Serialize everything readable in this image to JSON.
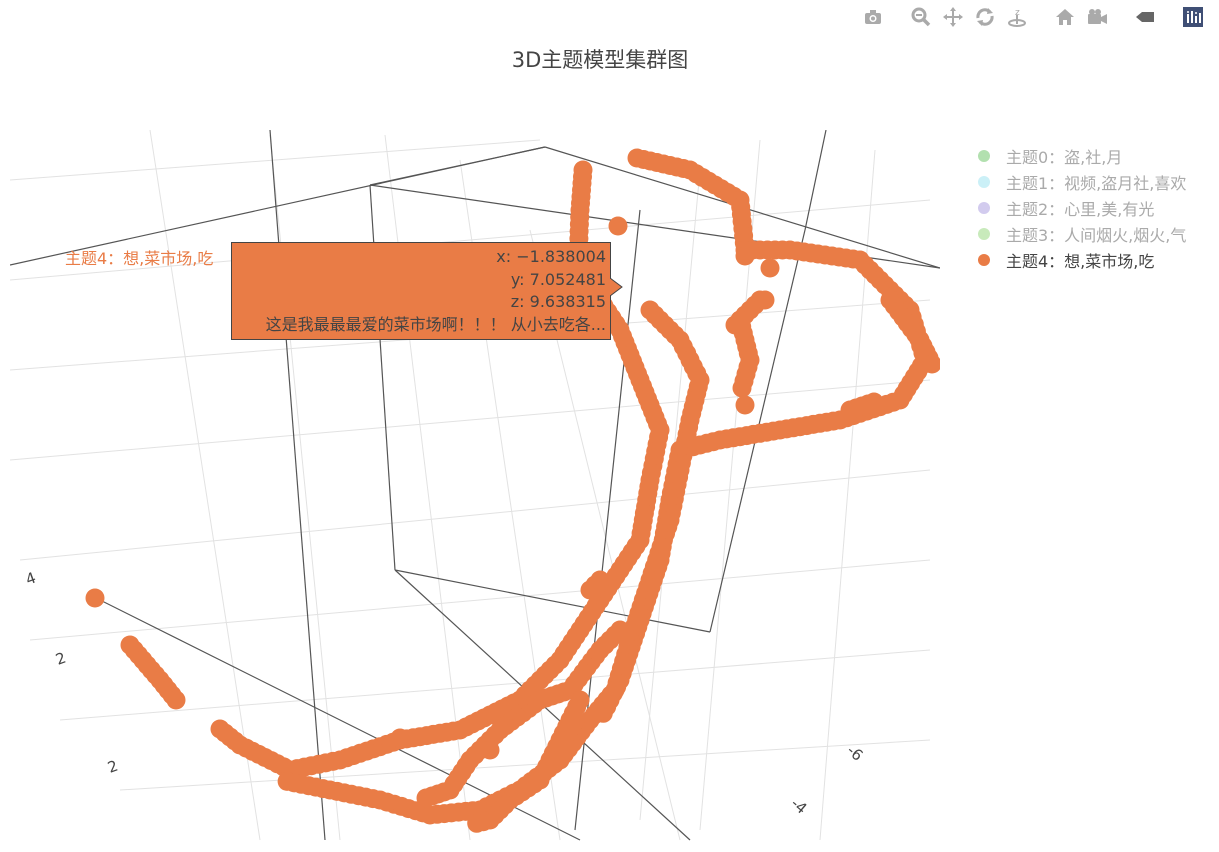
{
  "modebar": {
    "buttons": [
      {
        "name": "camera-icon",
        "group": 0
      },
      {
        "name": "zoom-icon",
        "group": 1
      },
      {
        "name": "pan-icon",
        "group": 1
      },
      {
        "name": "orbit-rotate-icon",
        "group": 1
      },
      {
        "name": "turntable-rotate-icon",
        "group": 1
      },
      {
        "name": "home-icon",
        "group": 2
      },
      {
        "name": "camera-view-icon",
        "group": 2
      },
      {
        "name": "hover-spike-icon",
        "group": 3
      },
      {
        "name": "plotly-logo-icon",
        "group": 4
      }
    ]
  },
  "chart_data": {
    "type": "scatter3d",
    "title": "3D主题模型集群图",
    "legend": {
      "placement": "right",
      "items": [
        {
          "label": "主题0：盗,社,月",
          "color": "#7ecb79",
          "visible": false
        },
        {
          "label": "主题1：视频,盗月社,喜欢",
          "color": "#a8e6f2",
          "visible": false
        },
        {
          "label": "主题2：心里,美,有光",
          "color": "#b4a9e3",
          "visible": false
        },
        {
          "label": "主题3：人间烟火,烟火,气",
          "color": "#a3dc8d",
          "visible": false
        },
        {
          "label": "主题4：想,菜市场,吃",
          "color": "#e97c46",
          "visible": true
        }
      ]
    },
    "tick_labels": [
      "4",
      "2",
      "2",
      "-6",
      "-4"
    ],
    "hover": {
      "trace_name": "主题4：想,菜市场,吃",
      "x": "x: −1.838004",
      "y": "y: 7.052481",
      "z": "z: 9.638315",
      "text": "这是我最最最爱的菜市场啊！！！ 从小去吃各..."
    },
    "marker_color": "#e97c46",
    "grid": true
  }
}
